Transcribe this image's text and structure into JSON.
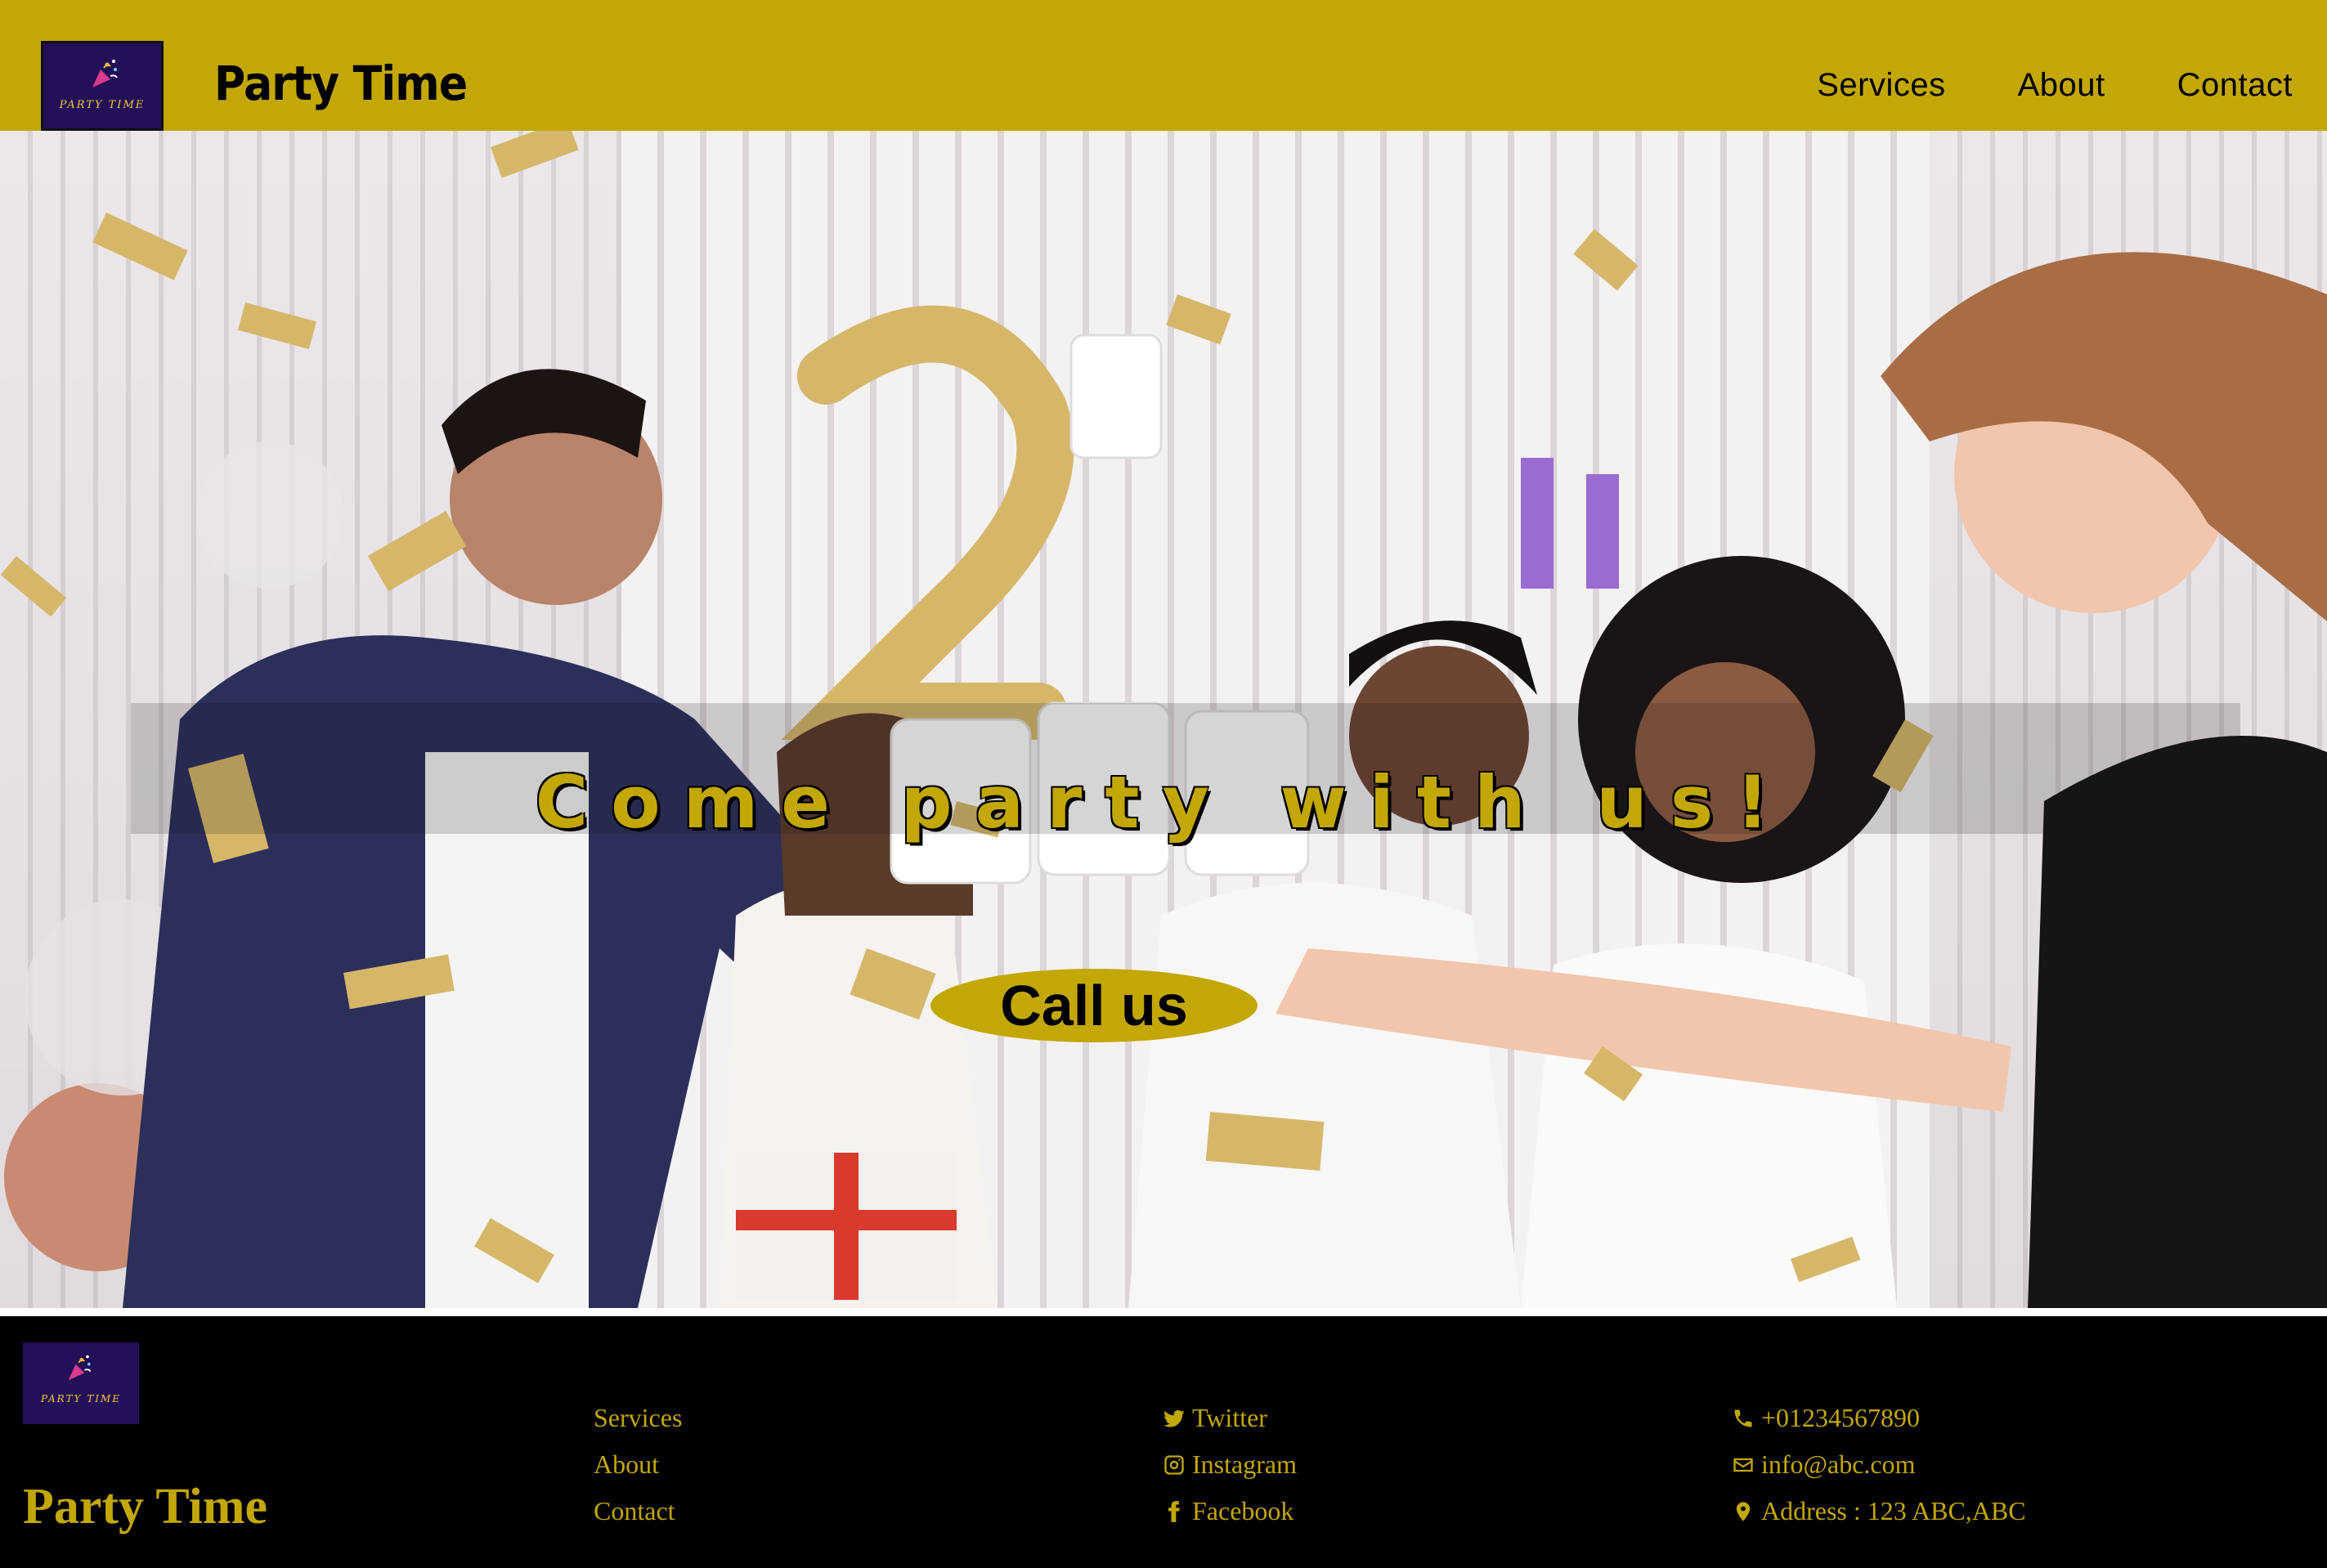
{
  "header": {
    "logo_text": "PARTY TIME",
    "brand": "Party Time",
    "nav": [
      "Services",
      "About",
      "Contact"
    ]
  },
  "hero": {
    "title": "Come party with us!",
    "button": "Call us"
  },
  "footer": {
    "logo_text": "PARTY TIME",
    "brand": "Party Time",
    "links": [
      "Services",
      "About",
      "Contact"
    ],
    "social": [
      {
        "icon": "twitter-icon",
        "label": "Twitter"
      },
      {
        "icon": "instagram-icon",
        "label": "Instagram"
      },
      {
        "icon": "facebook-icon",
        "label": "Facebook"
      }
    ],
    "contact": [
      {
        "icon": "phone-icon",
        "label": "+01234567890"
      },
      {
        "icon": "envelope-icon",
        "label": "info@abc.com"
      },
      {
        "icon": "map-marker-icon",
        "label": "Address : 123 ABC,ABC"
      }
    ]
  },
  "colors": {
    "accent": "#c2a705",
    "logo_bg": "#231056",
    "footer_bg": "#000000"
  }
}
